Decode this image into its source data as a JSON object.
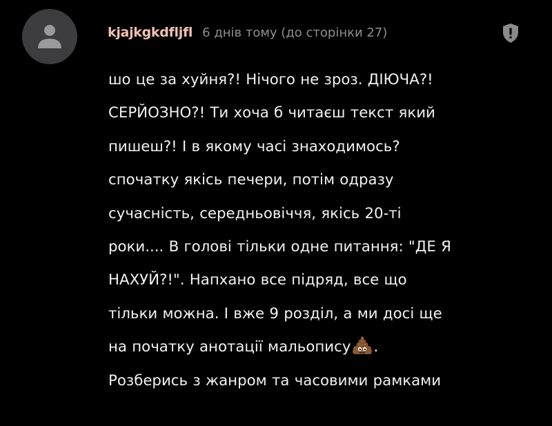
{
  "comment": {
    "author": "kjajkgkdfljfl",
    "timestamp": "6 днів тому (до сторінки 27)",
    "avatar_icon": "user-silhouette-icon",
    "report_icon": "shield-alert-icon",
    "emoji_icon": "pile-of-poo-emoji",
    "lines": [
      "шо це за хуйня?! Нічого не зроз. ДІЮЧА?!",
      "СЕРЙОЗНО?! Ти хоча б читаєш текст який",
      "пишеш?! І в якому часі знаходимось?",
      "спочатку якісь печери, потім одразу",
      "сучасність, середньовіччя, якісь 20-ті",
      "роки.... В голові тільки одне питання: \"ДЕ Я",
      "НАХУЙ?!\". Напхано все підряд, все що",
      "тільки можна. І вже 9 розділ, а ми досі ще",
      "на початку анотації мальопису",
      "Розберись з жанром та часовими рамками"
    ],
    "line_9_suffix": "."
  },
  "colors": {
    "background": "#000000",
    "avatar_bg": "#3d3d3f",
    "avatar_icon": "#9a9a9c",
    "username": "#f0c0b4",
    "timestamp": "#8f8f8f",
    "text": "#f2f2f2",
    "report_icon": "#8a8a8a"
  }
}
